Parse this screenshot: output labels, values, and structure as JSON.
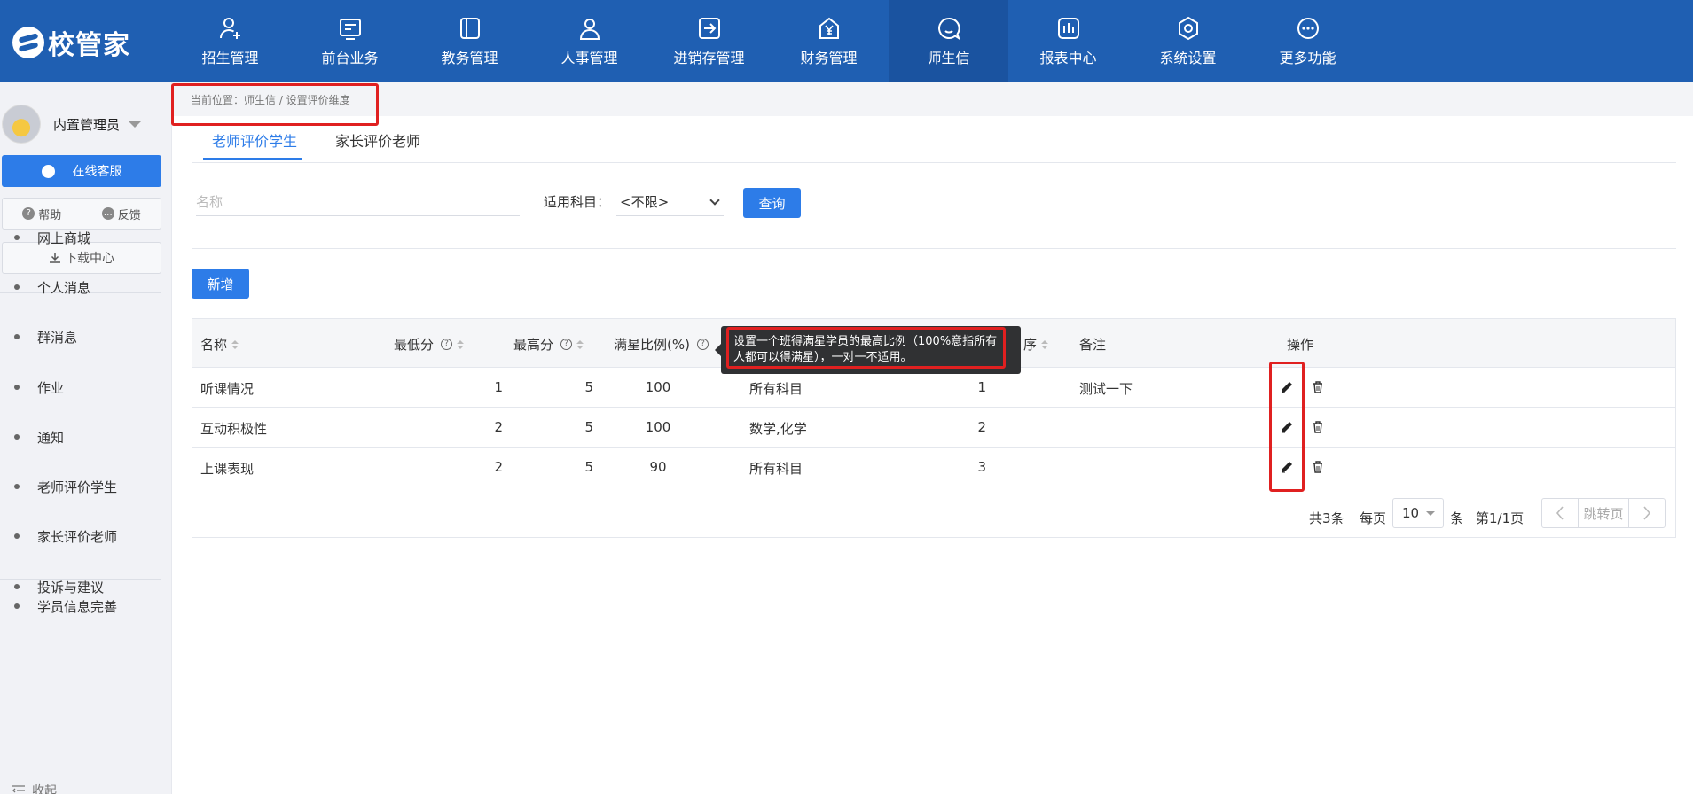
{
  "app": {
    "logo_text": "校管家"
  },
  "nav": {
    "items": [
      {
        "label": "招生管理",
        "icon": "user-plus-icon"
      },
      {
        "label": "前台业务",
        "icon": "desk-icon"
      },
      {
        "label": "教务管理",
        "icon": "book-icon"
      },
      {
        "label": "人事管理",
        "icon": "person-icon"
      },
      {
        "label": "进销存管理",
        "icon": "arrow-box-icon"
      },
      {
        "label": "财务管理",
        "icon": "yen-house-icon"
      },
      {
        "label": "师生信",
        "icon": "chat-icon",
        "active": true
      },
      {
        "label": "报表中心",
        "icon": "report-icon"
      },
      {
        "label": "系统设置",
        "icon": "hexagon-gear-icon"
      },
      {
        "label": "更多功能",
        "icon": "more-dots-icon"
      }
    ]
  },
  "sidebar": {
    "user_name": "内置管理员",
    "service_label": "在线客服",
    "help_label": "帮助",
    "feedback_label": "反馈",
    "download_label": "下载中心",
    "menu": [
      "网上商城",
      "个人消息",
      "群消息",
      "作业",
      "通知",
      "老师评价学生",
      "家长评价老师",
      "投诉与建议"
    ],
    "menu_extra": [
      "学员信息完善"
    ],
    "collapse_label": "收起"
  },
  "breadcrumb": {
    "text": "当前位置：师生信 / 设置评价维度"
  },
  "tabs": [
    "老师评价学生",
    "家长评价老师"
  ],
  "filter": {
    "name_placeholder": "名称",
    "subject_label": "适用科目：",
    "subject_value": "<不限>",
    "query_label": "查询"
  },
  "add_label": "新增",
  "table": {
    "headers": {
      "name": "名称",
      "min": "最低分",
      "max": "最高分",
      "ratio": "满星比例(%)",
      "sort_tail": "序",
      "remark": "备注",
      "ops": "操作"
    },
    "rows": [
      {
        "name": "听课情况",
        "min": "1",
        "max": "5",
        "ratio": "100",
        "subject": "所有科目",
        "order": "1",
        "remark": "测试一下"
      },
      {
        "name": "互动积极性",
        "min": "2",
        "max": "5",
        "ratio": "100",
        "subject": "数学,化学",
        "order": "2",
        "remark": ""
      },
      {
        "name": "上课表现",
        "min": "2",
        "max": "5",
        "ratio": "90",
        "subject": "所有科目",
        "order": "3",
        "remark": ""
      }
    ]
  },
  "pagination": {
    "total": "共3条",
    "per_page_label": "每页",
    "per_page_value": "10",
    "unit": "条",
    "page_info": "第1/1页",
    "jump_label": "跳转页"
  },
  "tooltip": {
    "line1": "设置一个班得满星学员的最高比例（100%意指所有",
    "line2": "人都可以得满星），一对一不适用。"
  },
  "colors": {
    "primary": "#2d7ce8",
    "topbar": "#1f5fb2",
    "highlight": "#e02020"
  }
}
